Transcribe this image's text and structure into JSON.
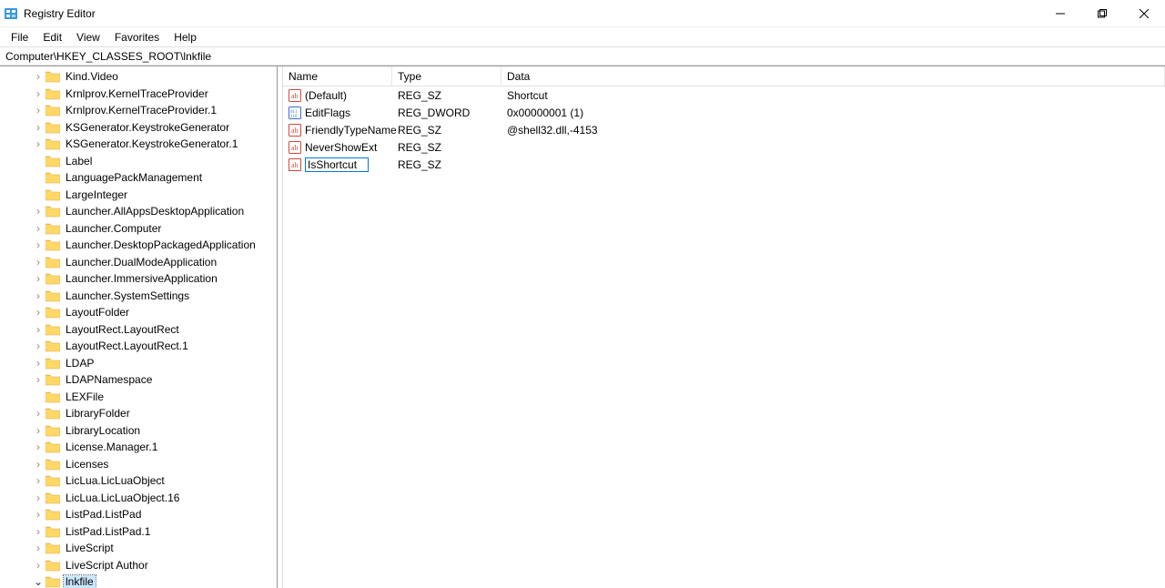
{
  "window": {
    "title": "Registry Editor"
  },
  "menu": {
    "file": "File",
    "edit": "Edit",
    "view": "View",
    "favorites": "Favorites",
    "help": "Help"
  },
  "address": "Computer\\HKEY_CLASSES_ROOT\\lnkfile",
  "tree": {
    "items": [
      {
        "label": "Kind.Video",
        "expandable": true,
        "expanded": false,
        "selected": false
      },
      {
        "label": "Krnlprov.KernelTraceProvider",
        "expandable": true,
        "expanded": false,
        "selected": false
      },
      {
        "label": "Krnlprov.KernelTraceProvider.1",
        "expandable": true,
        "expanded": false,
        "selected": false
      },
      {
        "label": "KSGenerator.KeystrokeGenerator",
        "expandable": true,
        "expanded": false,
        "selected": false
      },
      {
        "label": "KSGenerator.KeystrokeGenerator.1",
        "expandable": true,
        "expanded": false,
        "selected": false
      },
      {
        "label": "Label",
        "expandable": false,
        "expanded": false,
        "selected": false
      },
      {
        "label": "LanguagePackManagement",
        "expandable": false,
        "expanded": false,
        "selected": false
      },
      {
        "label": "LargeInteger",
        "expandable": false,
        "expanded": false,
        "selected": false
      },
      {
        "label": "Launcher.AllAppsDesktopApplication",
        "expandable": true,
        "expanded": false,
        "selected": false
      },
      {
        "label": "Launcher.Computer",
        "expandable": true,
        "expanded": false,
        "selected": false
      },
      {
        "label": "Launcher.DesktopPackagedApplication",
        "expandable": true,
        "expanded": false,
        "selected": false
      },
      {
        "label": "Launcher.DualModeApplication",
        "expandable": true,
        "expanded": false,
        "selected": false
      },
      {
        "label": "Launcher.ImmersiveApplication",
        "expandable": true,
        "expanded": false,
        "selected": false
      },
      {
        "label": "Launcher.SystemSettings",
        "expandable": true,
        "expanded": false,
        "selected": false
      },
      {
        "label": "LayoutFolder",
        "expandable": true,
        "expanded": false,
        "selected": false
      },
      {
        "label": "LayoutRect.LayoutRect",
        "expandable": true,
        "expanded": false,
        "selected": false
      },
      {
        "label": "LayoutRect.LayoutRect.1",
        "expandable": true,
        "expanded": false,
        "selected": false
      },
      {
        "label": "LDAP",
        "expandable": true,
        "expanded": false,
        "selected": false
      },
      {
        "label": "LDAPNamespace",
        "expandable": true,
        "expanded": false,
        "selected": false
      },
      {
        "label": "LEXFile",
        "expandable": false,
        "expanded": false,
        "selected": false
      },
      {
        "label": "LibraryFolder",
        "expandable": true,
        "expanded": false,
        "selected": false
      },
      {
        "label": "LibraryLocation",
        "expandable": true,
        "expanded": false,
        "selected": false
      },
      {
        "label": "License.Manager.1",
        "expandable": true,
        "expanded": false,
        "selected": false
      },
      {
        "label": "Licenses",
        "expandable": true,
        "expanded": false,
        "selected": false
      },
      {
        "label": "LicLua.LicLuaObject",
        "expandable": true,
        "expanded": false,
        "selected": false
      },
      {
        "label": "LicLua.LicLuaObject.16",
        "expandable": true,
        "expanded": false,
        "selected": false
      },
      {
        "label": "ListPad.ListPad",
        "expandable": true,
        "expanded": false,
        "selected": false
      },
      {
        "label": "ListPad.ListPad.1",
        "expandable": true,
        "expanded": false,
        "selected": false
      },
      {
        "label": "LiveScript",
        "expandable": true,
        "expanded": false,
        "selected": false
      },
      {
        "label": "LiveScript Author",
        "expandable": true,
        "expanded": false,
        "selected": false
      },
      {
        "label": "lnkfile",
        "expandable": true,
        "expanded": true,
        "selected": true
      }
    ]
  },
  "list": {
    "columns": {
      "name": "Name",
      "type": "Type",
      "data": "Data"
    },
    "rows": [
      {
        "name": "(Default)",
        "type": "REG_SZ",
        "data": "Shortcut",
        "iconKind": "string",
        "selected": false,
        "editing": false
      },
      {
        "name": "EditFlags",
        "type": "REG_DWORD",
        "data": "0x00000001 (1)",
        "iconKind": "binary",
        "selected": false,
        "editing": false
      },
      {
        "name": "FriendlyTypeName",
        "type": "REG_SZ",
        "data": "@shell32.dll,-4153",
        "iconKind": "string",
        "selected": false,
        "editing": false
      },
      {
        "name": "NeverShowExt",
        "type": "REG_SZ",
        "data": "",
        "iconKind": "string",
        "selected": false,
        "editing": false
      },
      {
        "name": "IsShortcut",
        "type": "REG_SZ",
        "data": "",
        "iconKind": "string",
        "selected": true,
        "editing": true
      }
    ]
  },
  "icons": {
    "app": "registry-editor-icon",
    "minimize": "minimize-icon",
    "maximize": "maximize-icon",
    "close": "close-icon",
    "folder": "folder-icon",
    "expand_collapsed": "▶",
    "expand_expanded": "▼"
  }
}
